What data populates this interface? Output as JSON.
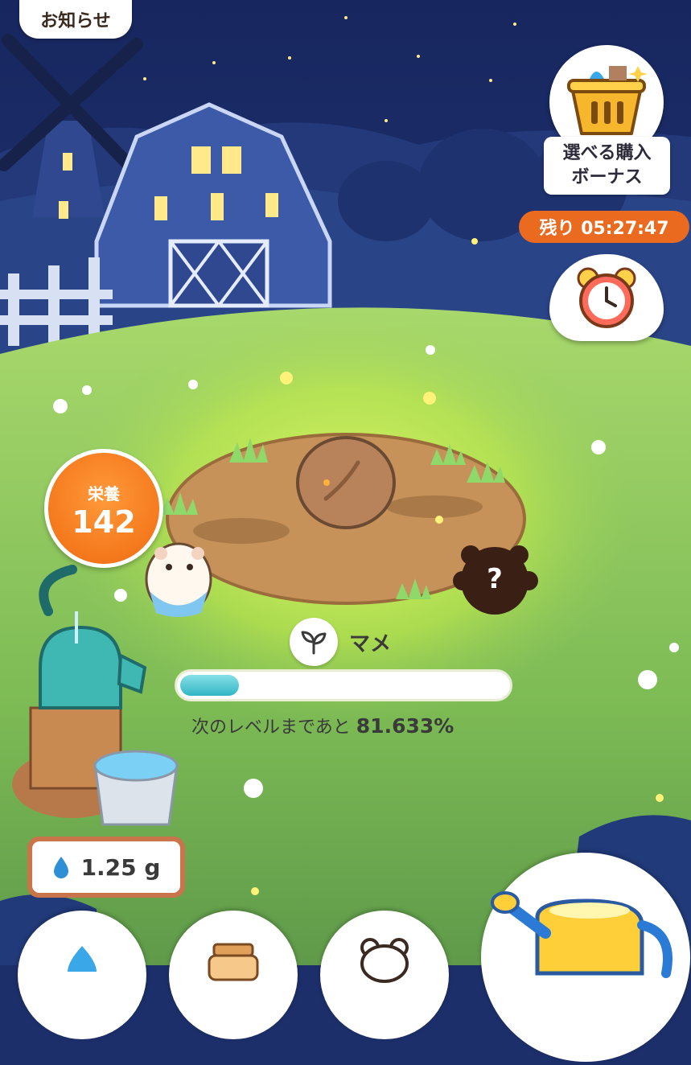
{
  "header": {
    "notice_label": "お知らせ"
  },
  "bonus": {
    "label_line1": "選べる購入",
    "label_line2": "ボーナス",
    "icon": "basket-icon"
  },
  "timer": {
    "label": "残り 05:27:47",
    "icon": "alarm-clock-icon"
  },
  "nutrition": {
    "label": "栄養",
    "value": "142"
  },
  "plant": {
    "name": "マメ",
    "icon": "sprout-icon",
    "seed_icon": "bean-seed-icon"
  },
  "progress": {
    "fraction": 0.18,
    "prefix": "次のレベルまであと",
    "percent": "81.633%"
  },
  "water": {
    "icon": "water-drop-icon",
    "amount": "1.25 g"
  },
  "characters": {
    "mystery_label": "?"
  },
  "bottom_nav": [
    {
      "icon": "water-drop-icon"
    },
    {
      "icon": "jar-icon"
    },
    {
      "icon": "bear-icon"
    },
    {
      "icon": "watering-can-icon"
    }
  ],
  "colors": {
    "accent_orange": "#ea6a20",
    "progress_teal": "#32b6c6",
    "grass": "#9cd25a"
  }
}
